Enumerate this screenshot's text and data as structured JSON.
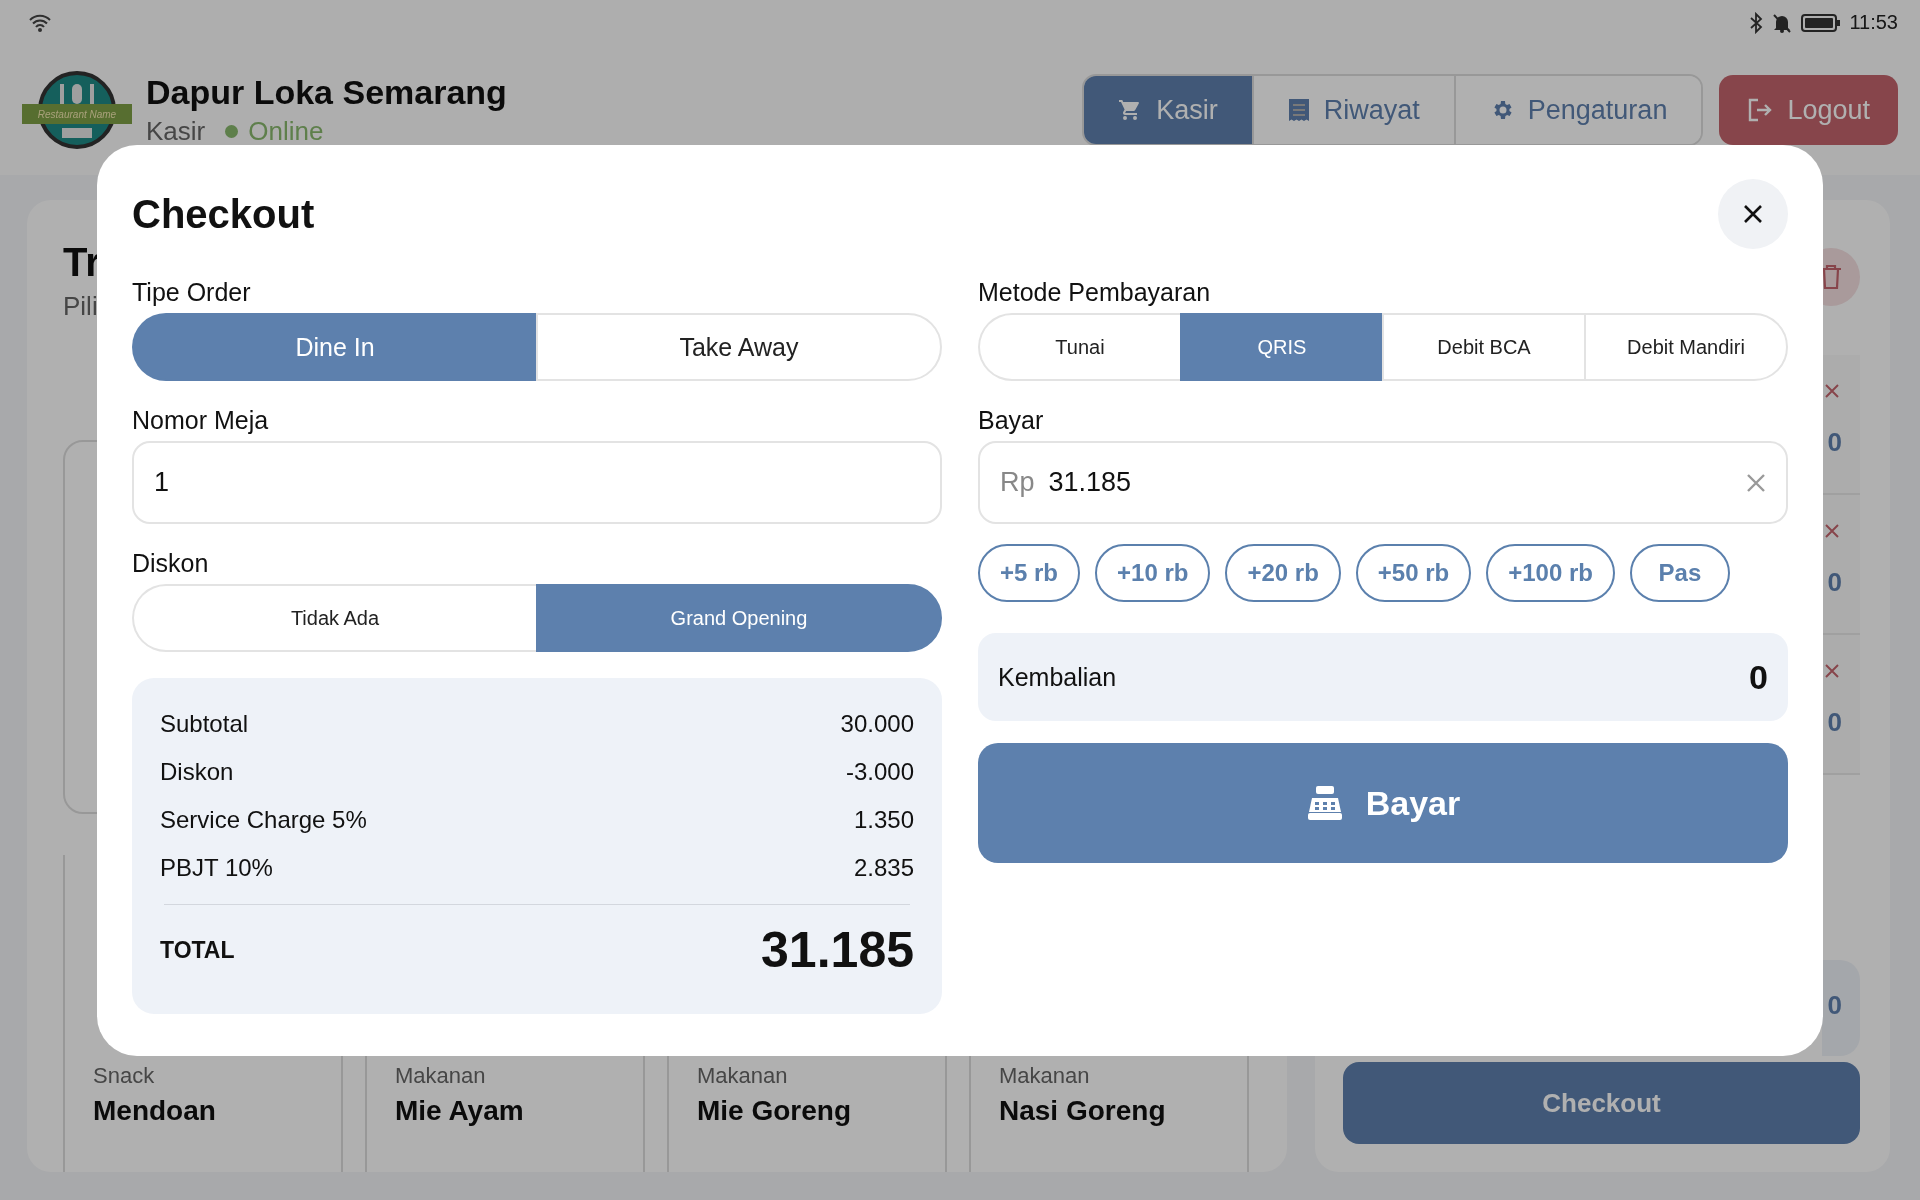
{
  "status_bar": {
    "time": "11:53"
  },
  "header": {
    "logo_text": "Restaurant Name",
    "restaurant_name": "Dapur Loka Semarang",
    "role": "Kasir",
    "status": "Online"
  },
  "nav": [
    {
      "label": "Kasir",
      "selected": true
    },
    {
      "label": "Riwayat",
      "selected": false
    },
    {
      "label": "Pengaturan",
      "selected": false
    }
  ],
  "logout": {
    "label": "Logout"
  },
  "products_panel": {
    "title": "Tr",
    "subtitle": "Pili",
    "products": [
      {
        "category": "Snack",
        "name": "Mendoan"
      },
      {
        "category": "Makanan",
        "name": "Mie Ayam"
      },
      {
        "category": "Makanan",
        "name": "Mie Goreng"
      },
      {
        "category": "Makanan",
        "name": "Nasi Goreng"
      }
    ]
  },
  "cart_panel": {
    "items": [
      {
        "amount": "0"
      },
      {
        "amount": "0"
      },
      {
        "amount": "0"
      }
    ],
    "summary_value": "0",
    "checkout_label": "Checkout"
  },
  "checkout_dialog": {
    "title": "Checkout",
    "order_type": {
      "label": "Tipe Order",
      "options": [
        {
          "label": "Dine In",
          "selected": true
        },
        {
          "label": "Take Away",
          "selected": false
        }
      ]
    },
    "table_number": {
      "label": "Nomor Meja",
      "value": "1"
    },
    "discount": {
      "label": "Diskon",
      "options": [
        {
          "label": "Tidak Ada",
          "selected": false
        },
        {
          "label": "Grand Opening",
          "selected": true
        }
      ]
    },
    "summary": {
      "rows": [
        {
          "label": "Subtotal",
          "value": "30.000"
        },
        {
          "label": "Diskon",
          "value": "-3.000"
        },
        {
          "label": "Service Charge 5%",
          "value": "1.350"
        },
        {
          "label": "PBJT 10%",
          "value": "2.835"
        }
      ],
      "total_label": "TOTAL",
      "total_value": "31.185"
    },
    "payment_method": {
      "label": "Metode Pembayaran",
      "options": [
        {
          "label": "Tunai",
          "selected": false
        },
        {
          "label": "QRIS",
          "selected": true
        },
        {
          "label": "Debit BCA",
          "selected": false
        },
        {
          "label": "Debit Mandiri",
          "selected": false
        }
      ]
    },
    "payment": {
      "label": "Bayar",
      "prefix": "Rp",
      "value": "31.185"
    },
    "quick_amounts": [
      "+5 rb",
      "+10 rb",
      "+20 rb",
      "+50 rb",
      "+100 rb",
      "Pas"
    ],
    "change": {
      "label": "Kembalian",
      "value": "0"
    },
    "pay_button": {
      "label": "Bayar"
    }
  }
}
